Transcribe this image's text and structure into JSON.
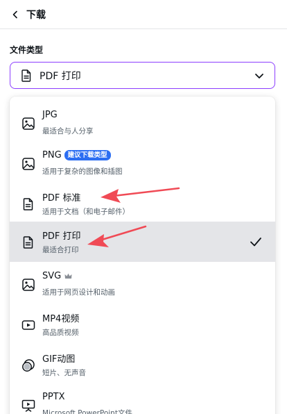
{
  "header": {
    "back_icon": "chevron-left-icon",
    "title": "下载"
  },
  "file_type": {
    "label": "文件类型",
    "selected": "PDF 打印",
    "selected_icon": "document-icon",
    "chevron_icon": "chevron-down-icon"
  },
  "options": [
    {
      "label": "JPG",
      "subtitle": "最适合与人分享",
      "icon": "image-icon"
    },
    {
      "label": "PNG",
      "badge": "建议下载类型",
      "subtitle": "适用于复杂的图像和插图",
      "icon": "image-icon"
    },
    {
      "label": "PDF 标准",
      "subtitle": "适用于文档（和电子邮件）",
      "icon": "document-icon"
    },
    {
      "label": "PDF 打印",
      "subtitle": "最适合打印",
      "icon": "document-icon",
      "selected": true
    },
    {
      "label": "SVG",
      "premium_icon": "crown-icon",
      "subtitle": "适用于网页设计和动画",
      "icon": "image-icon"
    },
    {
      "label": "MP4视频",
      "subtitle": "高品质视频",
      "icon": "video-icon"
    },
    {
      "label": "GIF动图",
      "subtitle": "短片、无声音",
      "icon": "gif-icon"
    },
    {
      "label": "PPTX",
      "subtitle": "Microsoft PowerPoint文件",
      "icon": "presentation-icon"
    }
  ],
  "colors": {
    "accent": "#8b3dff",
    "badge": "#2c6ef2",
    "selected_row": "#e4e5e8",
    "annotation_arrow": "#f04a55"
  }
}
